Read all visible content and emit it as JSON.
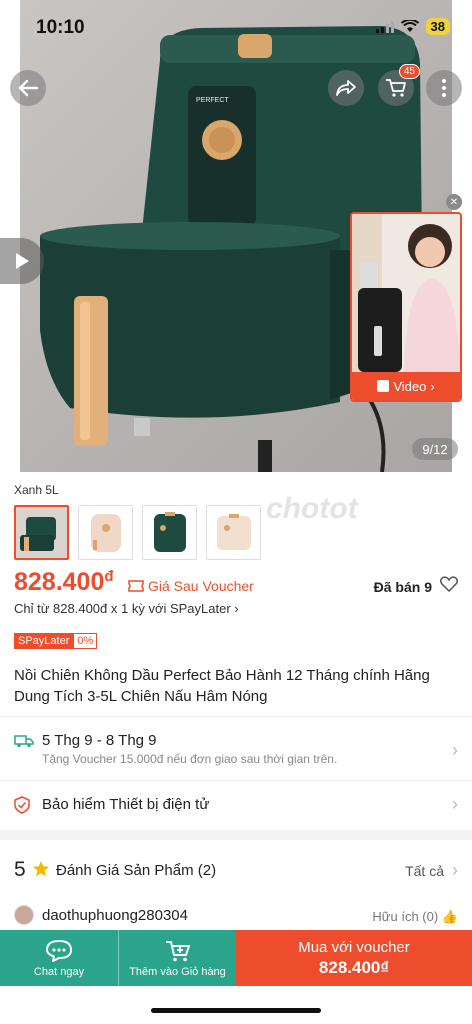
{
  "status": {
    "time": "10:10",
    "battery": "38"
  },
  "hero": {
    "cart_count": "45",
    "video_label": "Video",
    "page_indicator": "9/12"
  },
  "variants": {
    "label": "Xanh 5L",
    "watermark": "chotot"
  },
  "price": {
    "amount": "828.400",
    "currency": "đ",
    "voucher_tag": "Giá Sau Voucher",
    "sold": "Đã bán 9",
    "spaylater_line": "Chỉ từ 828.400đ x 1 kỳ với SPayLater",
    "spay_badge": "SPayLater",
    "spay_pct": "0%"
  },
  "product": {
    "title": "Nồi Chiên Không Dầu Perfect Bảo Hành 12 Tháng chính Hãng Dung Tích 3-5L Chiên Nấu Hâm Nóng"
  },
  "shipping": {
    "dates": "5 Thg 9 - 8 Thg 9",
    "voucher_note": "Tặng Voucher 15.000đ nếu đơn giao sau thời gian trên."
  },
  "insurance": {
    "label": "Bảo hiểm Thiết bị điện tử"
  },
  "rating": {
    "score": "5",
    "title": "Đánh Giá Sản Phẩm",
    "count": "(2)",
    "see_all": "Tất cả"
  },
  "review": {
    "reviewer": "daothuphuong280304",
    "helpful": "Hữu ích (0)"
  },
  "bottom": {
    "chat": "Chat ngay",
    "add_cart": "Thêm vào Giỏ hàng",
    "buy_label": "Mua với voucher",
    "buy_amount": "828.400₫"
  },
  "colors": {
    "accent": "#ee4d2d",
    "teal": "#2aa58b",
    "product_green": "#1f4a40",
    "gold": "#d9a66b"
  }
}
